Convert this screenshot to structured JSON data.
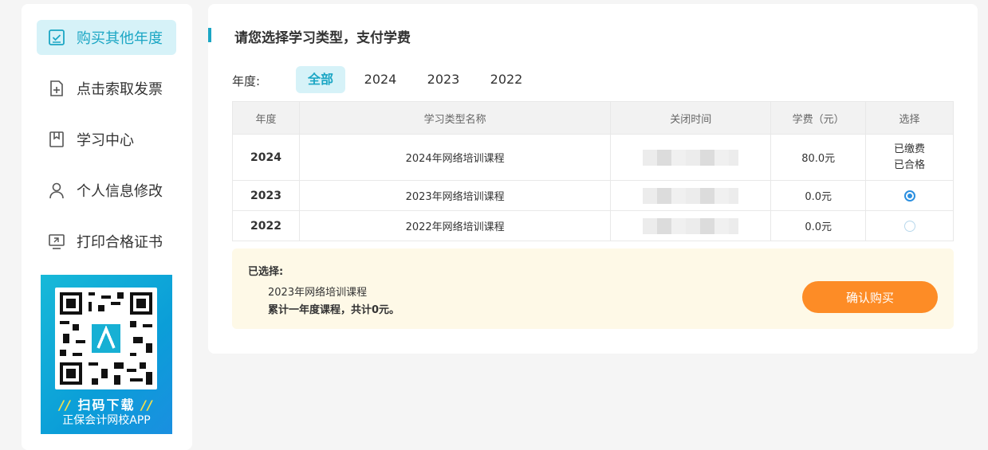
{
  "sidebar": {
    "items": [
      {
        "label": "购买其他年度",
        "icon": "checkbox-icon"
      },
      {
        "label": "点击索取发票",
        "icon": "document-add-icon"
      },
      {
        "label": "学习中心",
        "icon": "bookmark-icon"
      },
      {
        "label": "个人信息修改",
        "icon": "user-icon"
      },
      {
        "label": "打印合格证书",
        "icon": "monitor-icon"
      }
    ],
    "qr": {
      "slogan": "扫码下载",
      "caption": "正保会计网校APP"
    }
  },
  "main": {
    "title": "请您选择学习类型，支付学费",
    "year_filter": {
      "label": "年度:",
      "tabs": [
        "全部",
        "2024",
        "2023",
        "2022"
      ],
      "active": "全部"
    },
    "table": {
      "headers": [
        "年度",
        "学习类型名称",
        "关闭时间",
        "学费（元）",
        "选择"
      ],
      "rows": [
        {
          "year": "2024",
          "name": "2024年网络培训课程",
          "fee": "80.0元",
          "status_line1": "已缴费",
          "status_line2": "已合格"
        },
        {
          "year": "2023",
          "name": "2023年网络培训课程",
          "fee": "0.0元",
          "selected": true
        },
        {
          "year": "2022",
          "name": "2022年网络培训课程",
          "fee": "0.0元",
          "selected": false
        }
      ]
    },
    "summary": {
      "label": "已选择:",
      "course": "2023年网络培训课程",
      "total": "累计一年度课程，共计0元。",
      "button": "确认购买"
    }
  },
  "colors": {
    "accent": "#1ba6c4",
    "button": "#fd8c26",
    "summary_bg": "#fef9e7"
  }
}
